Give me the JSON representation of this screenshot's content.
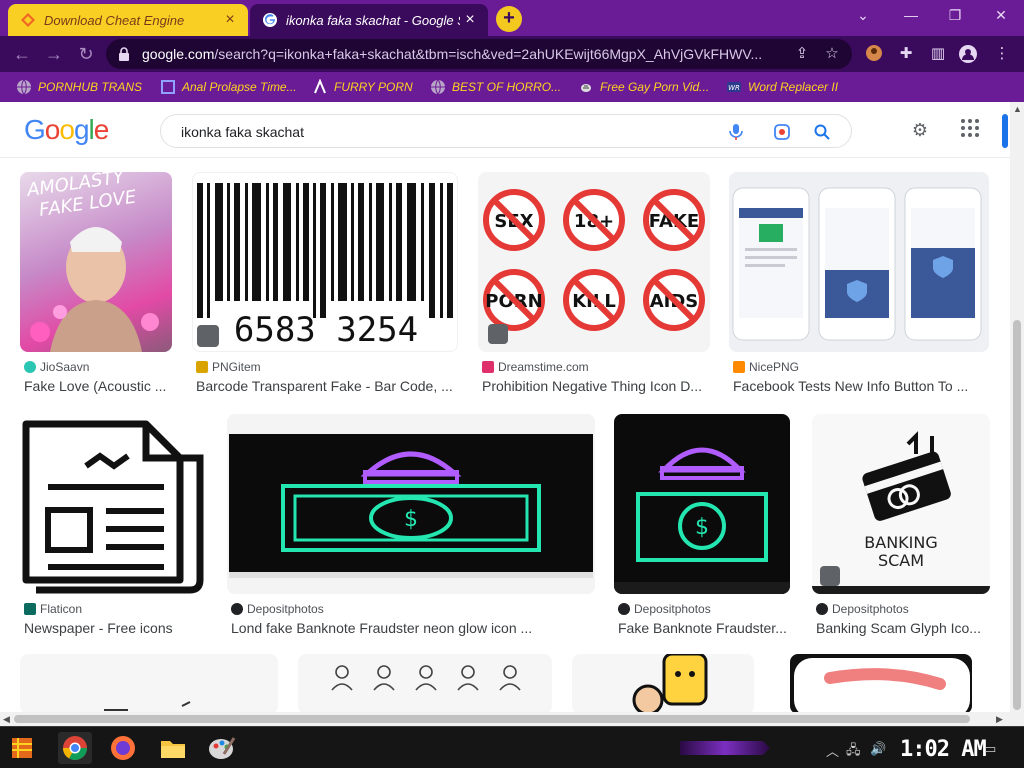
{
  "browser": {
    "tabs": [
      {
        "title": "Download Cheat Engine",
        "active": false
      },
      {
        "title": "ikonka faka skachat - Google Se",
        "active": true
      }
    ],
    "new_tab_label": "+",
    "close_glyph": "×",
    "url_host": "google.com",
    "url_path": "/search?q=ikonka+faka+skachat&tbm=isch&ved=2ahUKEwijt66MgpX_AhVjGVkFHWV...",
    "theme": {
      "tabstrip": "#6a1c96",
      "toolbar": "#3a0a5c",
      "accent_yellow": "#f9cf23"
    }
  },
  "bookmarks": [
    {
      "label": "PORNHUB TRANS",
      "icon": "globe-icon"
    },
    {
      "label": "Anal Prolapse Time...",
      "icon": "square-icon"
    },
    {
      "label": "FURRY PORN",
      "icon": "lambda-icon"
    },
    {
      "label": "BEST OF HORRO...",
      "icon": "globe-icon"
    },
    {
      "label": "Free Gay Porn Vid...",
      "icon": "bee-icon"
    },
    {
      "label": "Word Replacer II",
      "icon": "wr-icon"
    }
  ],
  "search": {
    "logo": "Google",
    "query": "ikonka faka skachat"
  },
  "results": [
    {
      "source": "JioSaavn",
      "caption": "Fake Love (Acoustic ...",
      "source_color": "#2bc5b4"
    },
    {
      "source": "PNGitem",
      "caption": "Barcode Transparent Fake - Bar Code, ...",
      "source_color": "#d9a400",
      "barcode_text": "6583   3254"
    },
    {
      "source": "Dreamstime.com",
      "caption": "Prohibition Negative Thing Icon D...",
      "source_color": "#e0306c",
      "signs": [
        "SEX",
        "18+",
        "FAKE",
        "PORN",
        "KILL",
        "AIDS"
      ]
    },
    {
      "source": "NicePNG",
      "caption": "Facebook Tests New Info Button To ...",
      "source_color": "#ff8a00"
    },
    {
      "source": "Flaticon",
      "caption": "Newspaper - Free icons",
      "source_color": "#0b6b5e"
    },
    {
      "source": "Depositphotos",
      "caption": "Lond fake Banknote Fraudster neon glow icon ...",
      "source_color": "#202124"
    },
    {
      "source": "Depositphotos",
      "caption": "Fake Banknote Fraudster...",
      "source_color": "#202124"
    },
    {
      "source": "Depositphotos",
      "caption": "Banking Scam Glyph Ico...",
      "source_color": "#202124",
      "thumb_text": "BANKING\nSCAM"
    }
  ],
  "taskbar": {
    "clock": "1:02 AM",
    "apps": [
      "start-icon",
      "chrome-icon",
      "firefox-icon",
      "file-explorer-icon",
      "paint-icon"
    ]
  }
}
